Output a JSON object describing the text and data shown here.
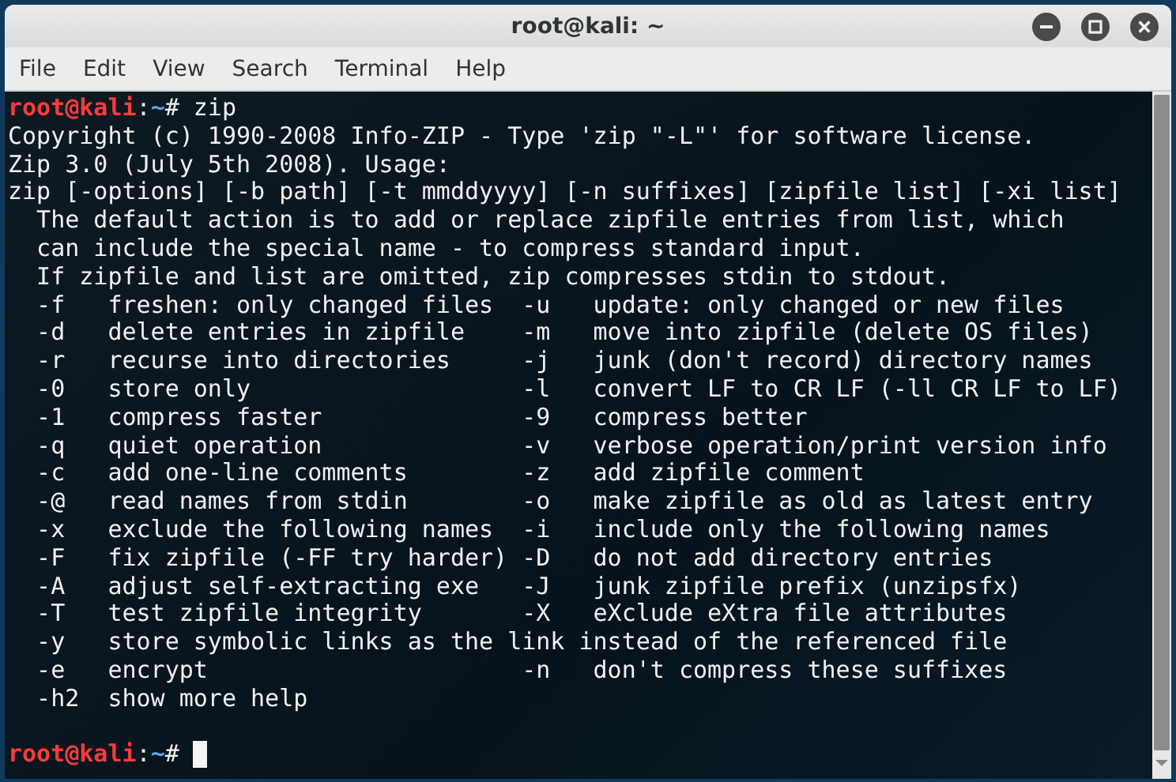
{
  "window": {
    "title": "root@kali: ~"
  },
  "menu": [
    {
      "label": "File"
    },
    {
      "label": "Edit"
    },
    {
      "label": "View"
    },
    {
      "label": "Search"
    },
    {
      "label": "Terminal"
    },
    {
      "label": "Help"
    }
  ],
  "terminal": {
    "lines": [
      {
        "kind": "prompt",
        "user": "root@kali",
        "separator": ":",
        "path": "~",
        "symbol": "#",
        "command": "zip",
        "cursor": false
      },
      {
        "kind": "output",
        "text": "Copyright (c) 1990-2008 Info-ZIP - Type 'zip \"-L\"' for software license."
      },
      {
        "kind": "output",
        "text": "Zip 3.0 (July 5th 2008). Usage:"
      },
      {
        "kind": "output",
        "text": "zip [-options] [-b path] [-t mmddyyyy] [-n suffixes] [zipfile list] [-xi list]"
      },
      {
        "kind": "output",
        "text": "  The default action is to add or replace zipfile entries from list, which"
      },
      {
        "kind": "output",
        "text": "  can include the special name - to compress standard input."
      },
      {
        "kind": "output",
        "text": "  If zipfile and list are omitted, zip compresses stdin to stdout."
      },
      {
        "kind": "output",
        "text": "  -f   freshen: only changed files  -u   update: only changed or new files"
      },
      {
        "kind": "output",
        "text": "  -d   delete entries in zipfile    -m   move into zipfile (delete OS files)"
      },
      {
        "kind": "output",
        "text": "  -r   recurse into directories     -j   junk (don't record) directory names"
      },
      {
        "kind": "output",
        "text": "  -0   store only                   -l   convert LF to CR LF (-ll CR LF to LF)"
      },
      {
        "kind": "output",
        "text": "  -1   compress faster              -9   compress better"
      },
      {
        "kind": "output",
        "text": "  -q   quiet operation              -v   verbose operation/print version info"
      },
      {
        "kind": "output",
        "text": "  -c   add one-line comments        -z   add zipfile comment"
      },
      {
        "kind": "output",
        "text": "  -@   read names from stdin        -o   make zipfile as old as latest entry"
      },
      {
        "kind": "output",
        "text": "  -x   exclude the following names  -i   include only the following names"
      },
      {
        "kind": "output",
        "text": "  -F   fix zipfile (-FF try harder) -D   do not add directory entries"
      },
      {
        "kind": "output",
        "text": "  -A   adjust self-extracting exe   -J   junk zipfile prefix (unzipsfx)"
      },
      {
        "kind": "output",
        "text": "  -T   test zipfile integrity       -X   eXclude eXtra file attributes"
      },
      {
        "kind": "output",
        "text": "  -y   store symbolic links as the link instead of the referenced file"
      },
      {
        "kind": "output",
        "text": "  -e   encrypt                      -n   don't compress these suffixes"
      },
      {
        "kind": "output",
        "text": "  -h2  show more help"
      },
      {
        "kind": "blank"
      },
      {
        "kind": "prompt",
        "user": "root@kali",
        "separator": ":",
        "path": "~",
        "symbol": "#",
        "cursor": true
      }
    ]
  }
}
